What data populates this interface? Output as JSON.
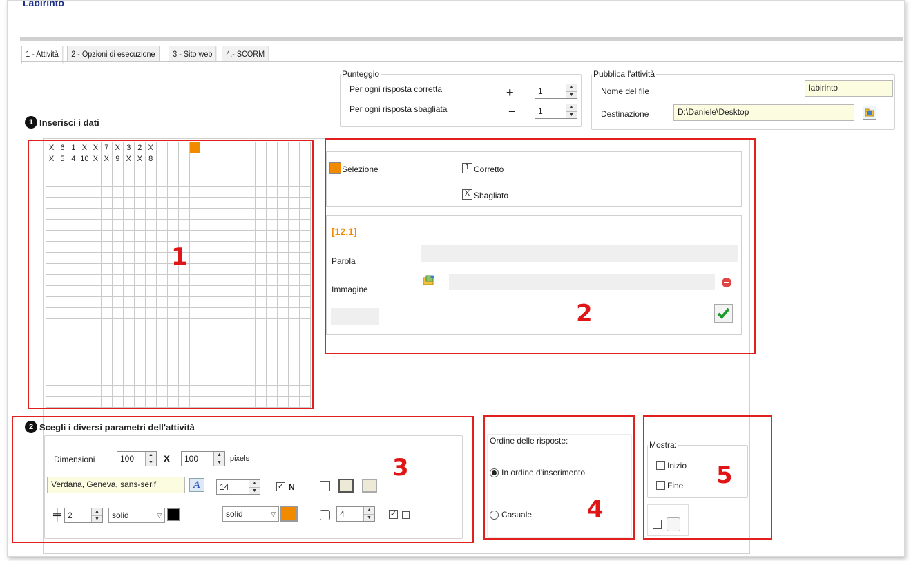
{
  "window": {
    "title": "Labirinto"
  },
  "tabs": [
    {
      "label": "1 - Attività"
    },
    {
      "label": "2 - Opzioni di esecuzione"
    },
    {
      "label": "3 - Sito web"
    },
    {
      "label": "4.- SCORM"
    }
  ],
  "punteggio": {
    "legend": "Punteggio",
    "correct_label": "Per ogni risposta corretta",
    "correct_sign": "+",
    "correct_value": "1",
    "wrong_label": "Per ogni risposta sbagliata",
    "wrong_sign": "−",
    "wrong_value": "1"
  },
  "pubblica": {
    "legend": "Pubblica l'attività",
    "file_label": "Nome del file",
    "file_value": "labirinto",
    "dest_label": "Destinazione",
    "dest_value": "D:\\Daniele\\Desktop"
  },
  "section1": {
    "number": "1",
    "title": "Inserisci i dati"
  },
  "grid": {
    "rows": 24,
    "cols": 24,
    "row1": [
      "X",
      "6",
      "1",
      "X",
      "X",
      "7",
      "X",
      "3",
      "2",
      "X",
      "",
      "",
      "",
      ""
    ],
    "row2": [
      "X",
      "5",
      "4",
      "10",
      "X",
      "X",
      "9",
      "X",
      "X",
      "8"
    ],
    "selected_cell": "[12,1]"
  },
  "legend_panel": {
    "selection_label": "Selezione",
    "selection_color": "#f28a00",
    "correct_box": "1",
    "correct_label": "Corretto",
    "wrong_box": "X",
    "wrong_label": "Sbagliato"
  },
  "cell_editor": {
    "coords": "[12,1]",
    "word_label": "Parola",
    "image_label": "Immagine"
  },
  "section2": {
    "number": "2",
    "title": "Scegli i diversi parametri dell'attività"
  },
  "params": {
    "dimensions_label": "Dimensioni",
    "width": "100",
    "times": "x",
    "height": "100",
    "unit": "pixels",
    "font": "Verdana, Geneva, sans-serif",
    "font_size": "14",
    "bold_label": "N",
    "border_width": "2",
    "border_style": "solid",
    "border_color": "#000000",
    "cell_style": "solid",
    "cell_color": "#f28a00",
    "spacing": "4"
  },
  "order": {
    "legend": "Ordine delle risposte:",
    "option1": "In ordine d'inserimento",
    "option2": "Casuale"
  },
  "show": {
    "legend": "Mostra:",
    "start": "Inizio",
    "end": "Fine"
  },
  "annotations": [
    "1",
    "2",
    "3",
    "4",
    "5"
  ]
}
